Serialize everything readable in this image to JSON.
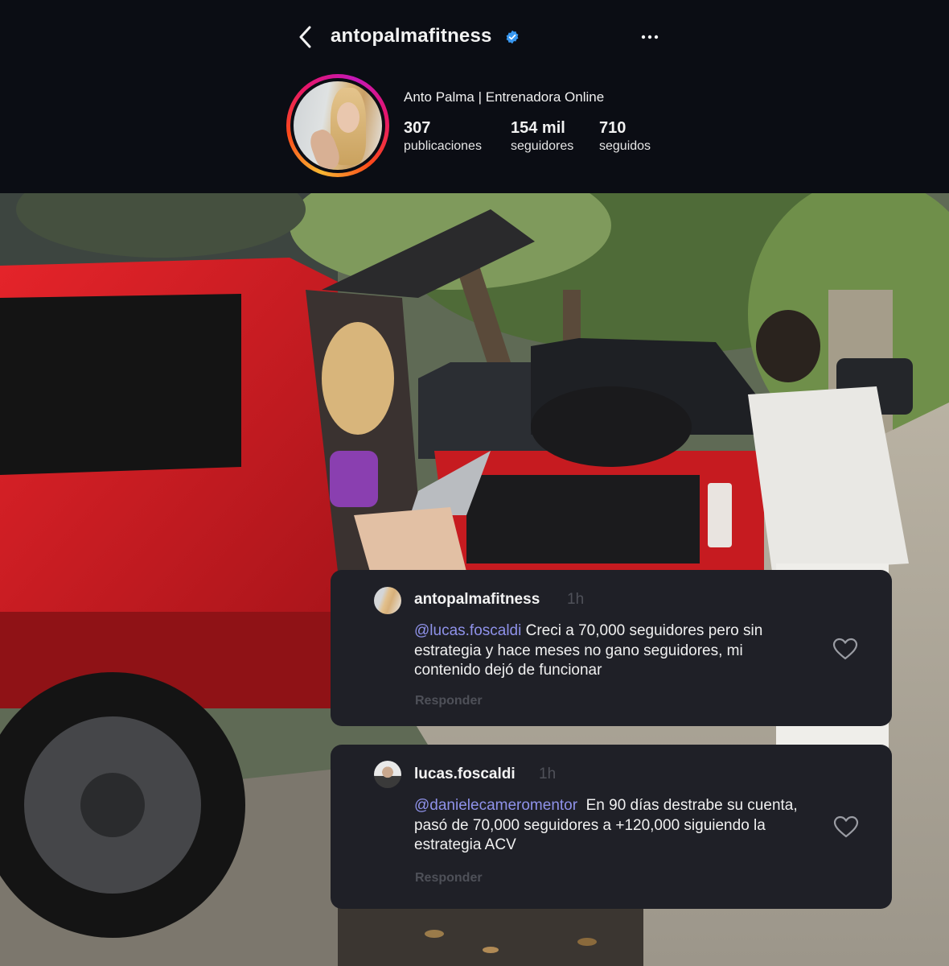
{
  "profile": {
    "username": "antopalmafitness",
    "full_name": "Anto Palma | Entrenadora Online",
    "stats": [
      {
        "value": "307",
        "label": "publicaciones"
      },
      {
        "value": "154 mil",
        "label": "seguidores"
      },
      {
        "value": "710",
        "label": "seguidos"
      }
    ],
    "icons": {
      "back": "back-chevron-icon",
      "verified": "verified-badge-icon",
      "more": "more-options-icon"
    },
    "colors": {
      "background": "#0b0d14",
      "verified": "#3897f0",
      "mention": "#8f92ea",
      "card": "#1f2027"
    }
  },
  "comments": [
    {
      "username": "antopalmafitness",
      "time": "1h",
      "mention": "@lucas.foscaldi",
      "text": " Creci a 70,000 seguidores pero sin estrategia y hace meses no gano seguidores, mi contenido dejó de funcionar",
      "reply_label": "Responder"
    },
    {
      "username": "lucas.foscaldi",
      "time": "1h",
      "mention": "@danielecameromentor",
      "text": "  En 90 días destrabe su cuenta, pasó de 70,000 seguidores a +120,000 siguiendo la estrategia ACV",
      "reply_label": "Responder"
    }
  ]
}
